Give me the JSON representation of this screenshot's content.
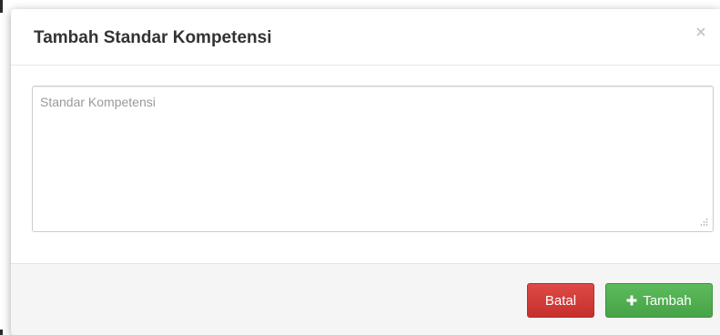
{
  "modal": {
    "title": "Tambah Standar Kompetensi",
    "close_icon": "close-icon",
    "close_glyph": "×"
  },
  "form": {
    "standar_kompetensi": {
      "placeholder": "Standar Kompetensi",
      "value": ""
    }
  },
  "footer": {
    "cancel_label": "Batal",
    "submit_label": "Tambah",
    "submit_icon": "plus-icon"
  },
  "colors": {
    "danger": "#d9534f",
    "success": "#5cb85c",
    "title_text": "#333333",
    "footer_bg": "#f5f5f5"
  }
}
